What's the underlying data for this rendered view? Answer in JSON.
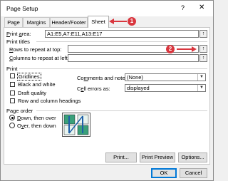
{
  "window": {
    "title": "Page Setup",
    "help_icon": "?",
    "close_icon": "✕"
  },
  "tabs": [
    {
      "label": "Page"
    },
    {
      "label": "Margins"
    },
    {
      "label": "Header/Footer"
    },
    {
      "label": "Sheet",
      "active": true
    }
  ],
  "annotations": {
    "marker1": "1",
    "marker2": "2",
    "color": "#d9363e"
  },
  "print_area": {
    "label": "Print area:",
    "value": "A1:E5,A7:E11,A13:E17"
  },
  "print_titles": {
    "heading": "Print titles",
    "rows_label": "Rows to repeat at top:",
    "rows_value": "",
    "columns_label": "Columns to repeat at left:",
    "columns_value": ""
  },
  "print": {
    "heading": "Print",
    "gridlines": {
      "label": "Gridlines",
      "checked": false
    },
    "black_white": {
      "label": "Black and white",
      "checked": false
    },
    "draft": {
      "label": "Draft quality",
      "checked": false
    },
    "rowcol_headings": {
      "label": "Row and column headings",
      "checked": false
    },
    "comments_label": "Comments and notes:",
    "comments_value": "(None)",
    "errors_label": "Cell errors as:",
    "errors_value": "displayed"
  },
  "page_order": {
    "heading": "Page order",
    "down_over": {
      "label": "Down, then over",
      "selected": true
    },
    "over_down": {
      "label": "Over, then down",
      "selected": false
    }
  },
  "buttons": {
    "print": "Print...",
    "preview": "Print Preview",
    "options": "Options...",
    "ok": "OK",
    "cancel": "Cancel"
  },
  "colors": {
    "accent": "#0078d7",
    "active_tab_bg": "#ffffff",
    "panel_bg": "#f0f0f0"
  }
}
